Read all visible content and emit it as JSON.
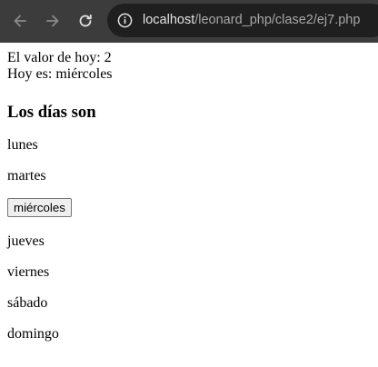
{
  "browser": {
    "url_host": "localhost",
    "url_path": "/leonard_php/clase2/ej7.php"
  },
  "page": {
    "valor_line": "El valor de hoy: 2",
    "hoy_line": "Hoy es: miércoles",
    "heading": "Los días son",
    "days": [
      "lunes",
      "martes",
      "miércoles",
      "jueves",
      "viernes",
      "sábado",
      "domingo"
    ]
  }
}
